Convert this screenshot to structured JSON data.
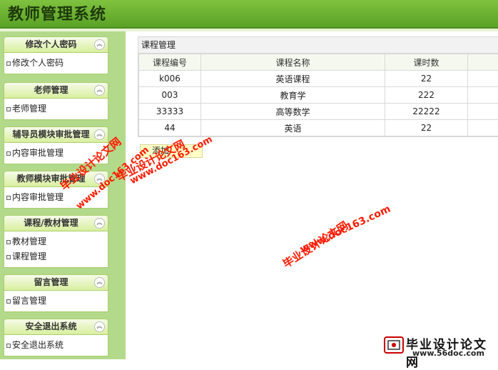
{
  "app": {
    "title": "教师管理系统"
  },
  "sidebar": {
    "panels": [
      {
        "title": "修改个人密码",
        "items": [
          "修改个人密码"
        ]
      },
      {
        "title": "老师管理",
        "items": [
          "老师管理"
        ]
      },
      {
        "title": "辅导员模块审批管理",
        "items": [
          "内容审批管理"
        ]
      },
      {
        "title": "教师模块审批管理",
        "items": [
          "内容审批管理"
        ]
      },
      {
        "title": "课程/教材管理",
        "items": [
          "教材管理",
          "课程管理"
        ]
      },
      {
        "title": "留言管理",
        "items": [
          "留言管理"
        ]
      },
      {
        "title": "安全退出系统",
        "items": [
          "安全退出系统"
        ]
      }
    ],
    "collapse_glyph": "︽"
  },
  "course": {
    "title": "课程管理",
    "headers": [
      "课程编号",
      "课程名称",
      "课时数"
    ],
    "rows": [
      [
        "k006",
        "英语课程",
        "22"
      ],
      [
        "003",
        "教育学",
        "222"
      ],
      [
        "33333",
        "高等数学",
        "22222"
      ],
      [
        "44",
        "英语",
        "22"
      ]
    ],
    "add_label": "添加"
  },
  "watermark": {
    "cn": "毕业设计论文网",
    "url": "www.doc163.com"
  },
  "logo": {
    "text": "毕业设计论文网",
    "url": "www.56doc.com"
  }
}
